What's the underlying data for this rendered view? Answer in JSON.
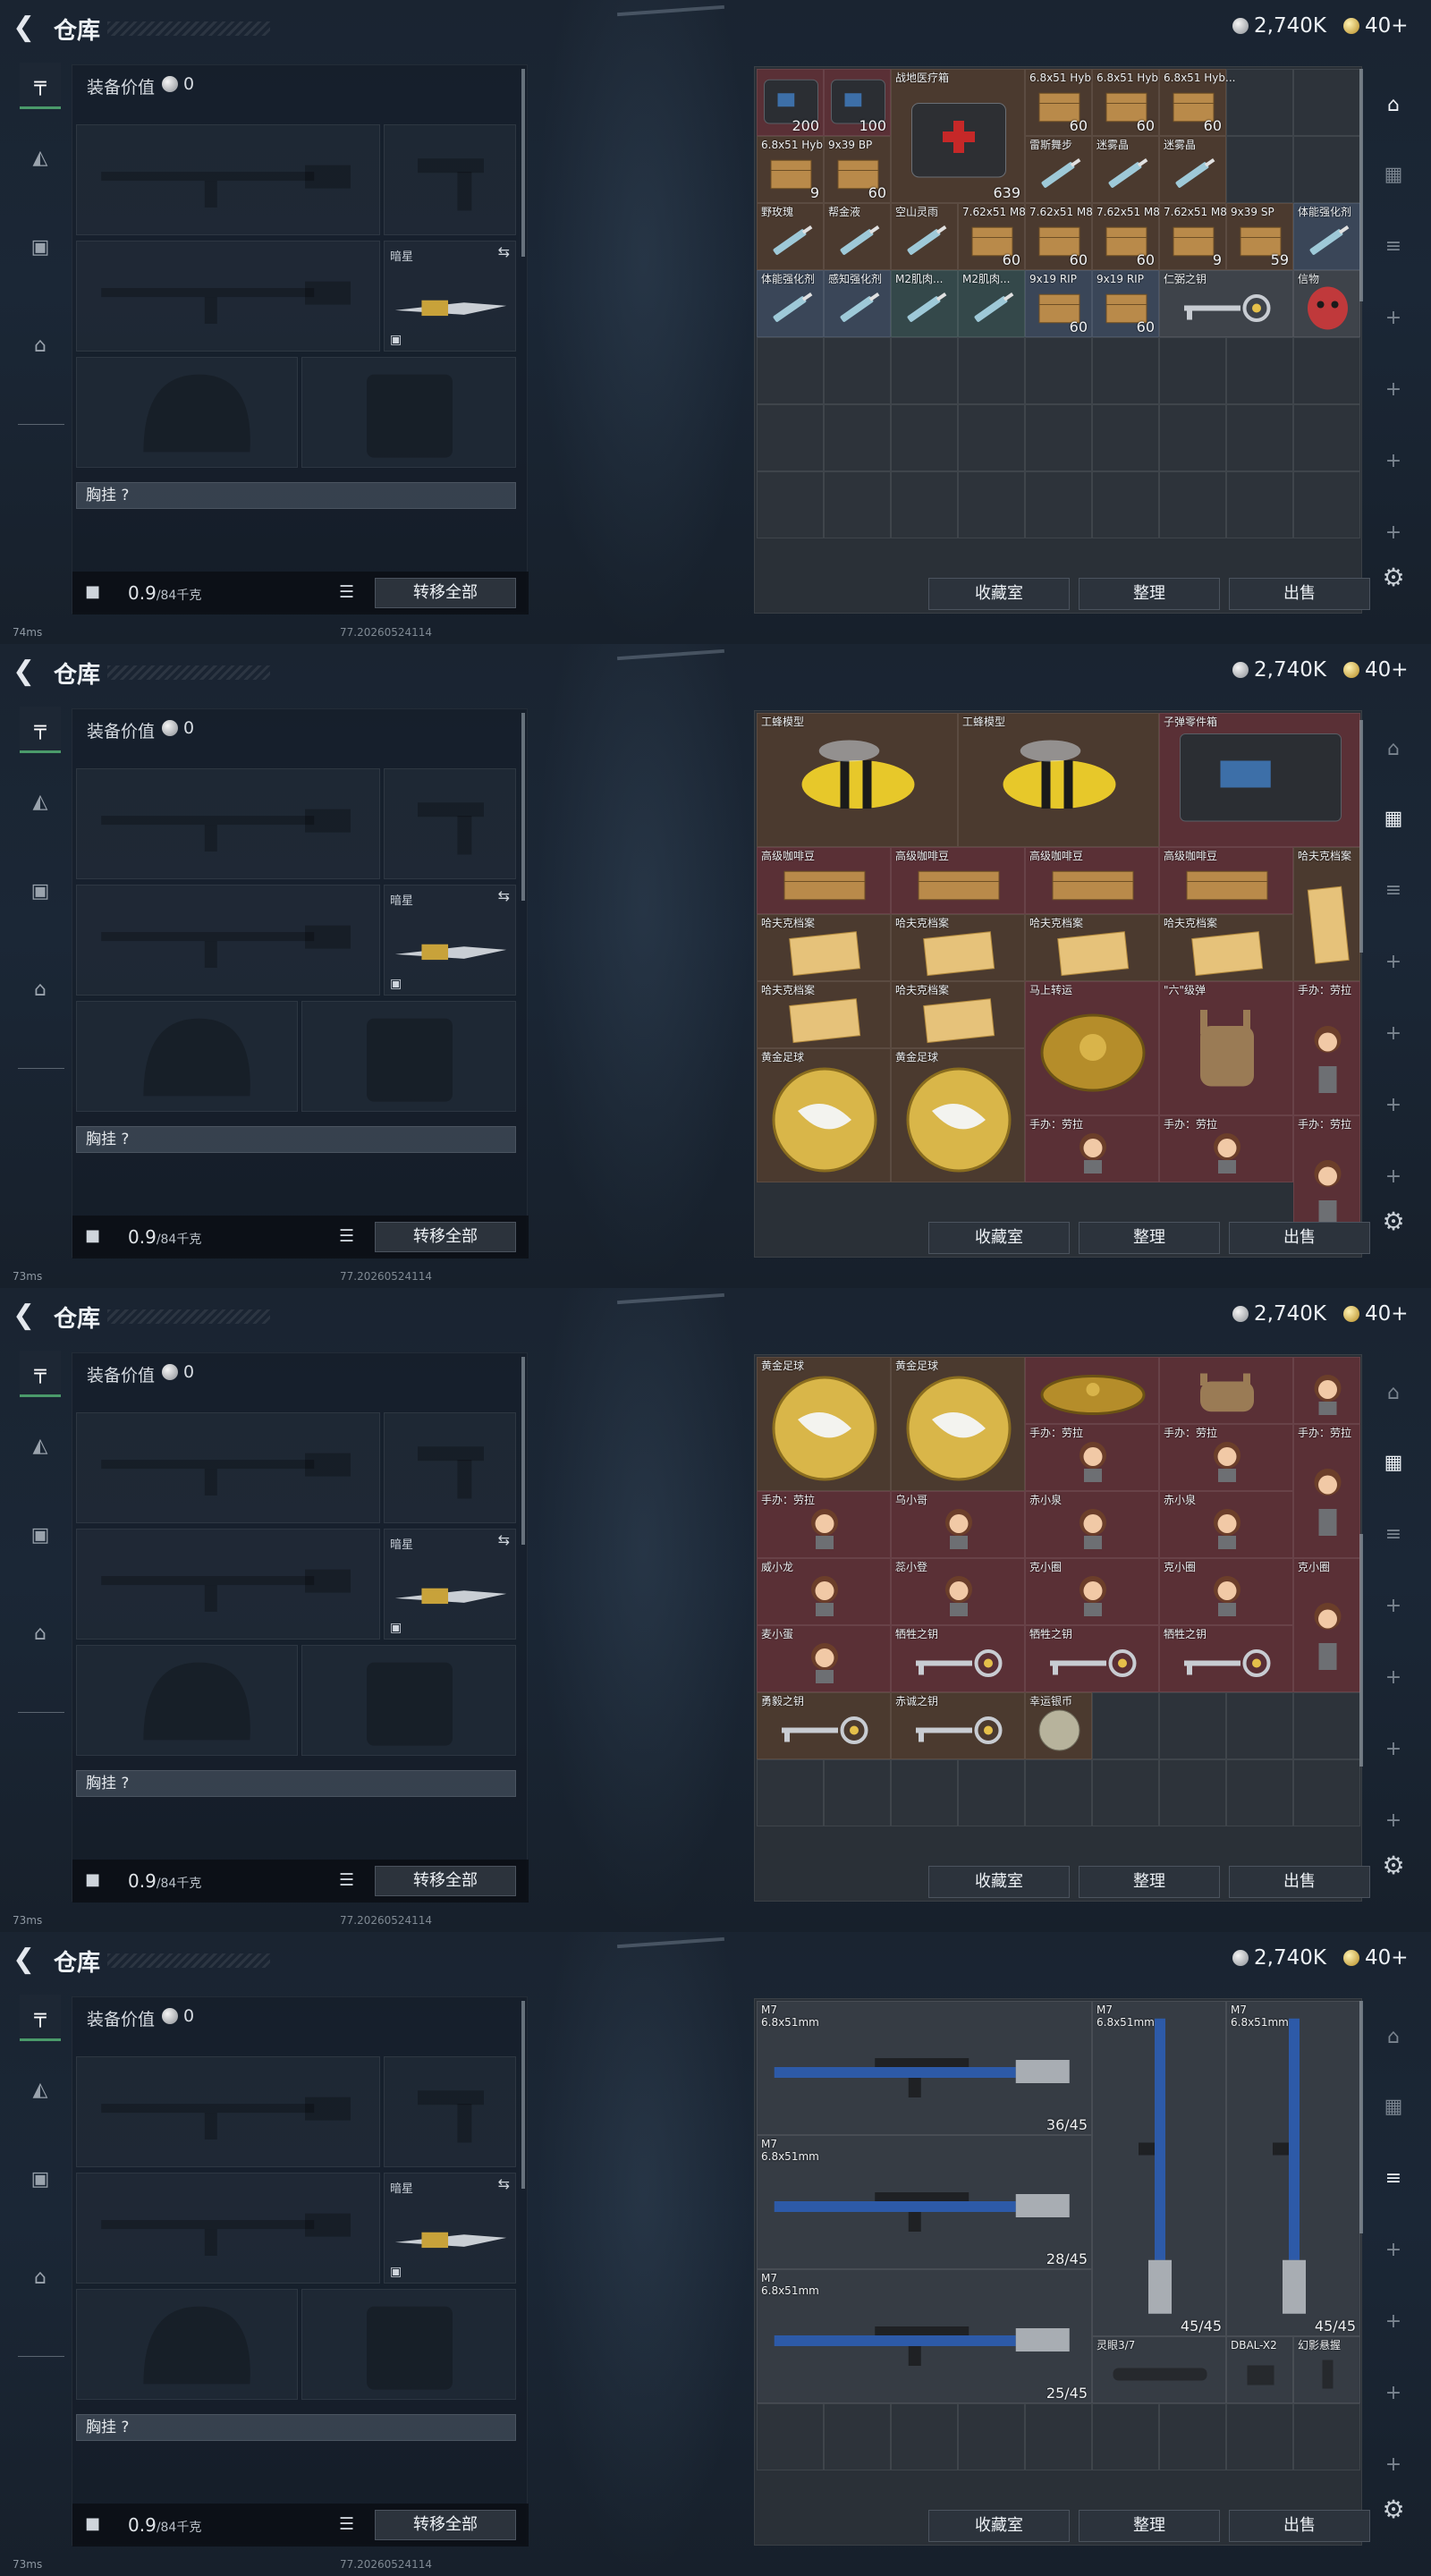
{
  "header": {
    "title": "仓库",
    "silver": "2,740K",
    "gold": "40+"
  },
  "equip": {
    "title": "装备价值",
    "value": "0",
    "melee_label": "暗星",
    "chest_label": "胸挂 ?",
    "weight_main": "0.9",
    "weight_unit": "/84千克",
    "transfer": "转移全部"
  },
  "footer": {
    "btn1": "收藏室",
    "btn2": "整理",
    "btn3": "出售"
  },
  "panels": [
    {
      "status": "74ms",
      "build": "77.20260524114"
    },
    {
      "status": "73ms",
      "build": "77.20260524114"
    },
    {
      "status": "73ms",
      "build": "77.20260524114"
    },
    {
      "status": "73ms",
      "build": "77.20260524114"
    }
  ],
  "icons": {
    "back": "back-arrow-icon",
    "silver": "silver-coin-icon",
    "gold": "gold-coin-icon",
    "lock": "lock-icon",
    "list": "list-icon",
    "gear": "gear-icon",
    "swap": "swap-icon"
  },
  "grids": [
    {
      "cells": [
        {
          "c": 0,
          "r": 0,
          "w": 1,
          "h": 1,
          "bg": "red",
          "label": "",
          "count": "200",
          "shape": "case"
        },
        {
          "c": 1,
          "r": 0,
          "w": 1,
          "h": 1,
          "bg": "red",
          "label": "",
          "count": "100",
          "shape": "case"
        },
        {
          "c": 2,
          "r": 0,
          "w": 2,
          "h": 2,
          "bg": "brown",
          "label": "战地医疗箱",
          "count": "639",
          "shape": "medkit"
        },
        {
          "c": 4,
          "r": 0,
          "w": 1,
          "h": 1,
          "bg": "brown",
          "label": "6.8x51 Hyb...",
          "count": "60",
          "shape": "box"
        },
        {
          "c": 5,
          "r": 0,
          "w": 1,
          "h": 1,
          "bg": "brown",
          "label": "6.8x51 Hyb...",
          "count": "60",
          "shape": "box"
        },
        {
          "c": 6,
          "r": 0,
          "w": 1,
          "h": 1,
          "bg": "brown",
          "label": "6.8x51 Hyb...",
          "count": "60",
          "shape": "box"
        },
        {
          "c": 0,
          "r": 1,
          "w": 1,
          "h": 1,
          "bg": "brown",
          "label": "6.8x51 Hyb...",
          "count": "9",
          "shape": "box"
        },
        {
          "c": 1,
          "r": 1,
          "w": 1,
          "h": 1,
          "bg": "brown",
          "label": "9x39 BP",
          "count": "60",
          "shape": "box"
        },
        {
          "c": 4,
          "r": 1,
          "w": 1,
          "h": 1,
          "bg": "brown",
          "label": "雷斯舞步",
          "count": "",
          "shape": "syringe"
        },
        {
          "c": 5,
          "r": 1,
          "w": 1,
          "h": 1,
          "bg": "brown",
          "label": "迷雾晶",
          "count": "",
          "shape": "syringe"
        },
        {
          "c": 6,
          "r": 1,
          "w": 1,
          "h": 1,
          "bg": "brown",
          "label": "迷雾晶",
          "count": "",
          "shape": "syringe"
        },
        {
          "c": 0,
          "r": 2,
          "w": 1,
          "h": 1,
          "bg": "brown",
          "label": "野玫瑰",
          "count": "",
          "shape": "syringe"
        },
        {
          "c": 1,
          "r": 2,
          "w": 1,
          "h": 1,
          "bg": "brown",
          "label": "帮金液",
          "count": "",
          "shape": "syringe"
        },
        {
          "c": 2,
          "r": 2,
          "w": 1,
          "h": 1,
          "bg": "brown",
          "label": "空山灵雨",
          "count": "",
          "shape": "syringe"
        },
        {
          "c": 3,
          "r": 2,
          "w": 1,
          "h": 1,
          "bg": "brown",
          "label": "7.62x51 M80",
          "count": "60",
          "shape": "box"
        },
        {
          "c": 4,
          "r": 2,
          "w": 1,
          "h": 1,
          "bg": "brown",
          "label": "7.62x51 M80",
          "count": "60",
          "shape": "box"
        },
        {
          "c": 5,
          "r": 2,
          "w": 1,
          "h": 1,
          "bg": "brown",
          "label": "7.62x51 M80",
          "count": "60",
          "shape": "box"
        },
        {
          "c": 6,
          "r": 2,
          "w": 1,
          "h": 1,
          "bg": "brown",
          "label": "7.62x51 M80",
          "count": "9",
          "shape": "box"
        },
        {
          "c": 7,
          "r": 2,
          "w": 1,
          "h": 1,
          "bg": "brown",
          "label": "9x39 SP",
          "count": "59",
          "shape": "box"
        },
        {
          "c": 8,
          "r": 2,
          "w": 1,
          "h": 1,
          "bg": "blue",
          "label": "体能强化剂",
          "count": "",
          "shape": "syringe"
        },
        {
          "c": 0,
          "r": 3,
          "w": 1,
          "h": 1,
          "bg": "blue",
          "label": "体能强化剂",
          "count": "",
          "shape": "syringe"
        },
        {
          "c": 1,
          "r": 3,
          "w": 1,
          "h": 1,
          "bg": "blue",
          "label": "感知强化剂",
          "count": "",
          "shape": "syringe"
        },
        {
          "c": 2,
          "r": 3,
          "w": 1,
          "h": 1,
          "bg": "teal",
          "label": "M2肌肉...",
          "count": "",
          "shape": "syringe"
        },
        {
          "c": 3,
          "r": 3,
          "w": 1,
          "h": 1,
          "bg": "teal",
          "label": "M2肌肉...",
          "count": "",
          "shape": "syringe"
        },
        {
          "c": 4,
          "r": 3,
          "w": 1,
          "h": 1,
          "bg": "blue",
          "label": "9x19 RIP",
          "count": "60",
          "shape": "box"
        },
        {
          "c": 5,
          "r": 3,
          "w": 1,
          "h": 1,
          "bg": "blue",
          "label": "9x19 RIP",
          "count": "60",
          "shape": "box"
        },
        {
          "c": 6,
          "r": 3,
          "w": 2,
          "h": 1,
          "bg": "gray",
          "label": "仁弼之钥",
          "count": "",
          "shape": "key"
        },
        {
          "c": 8,
          "r": 3,
          "w": 1,
          "h": 1,
          "bg": "gray",
          "label": "信物",
          "count": "",
          "shape": "mask"
        }
      ]
    },
    {
      "cells": [
        {
          "c": 0,
          "r": 0,
          "w": 3,
          "h": 2,
          "bg": "brown",
          "label": "工蜂模型",
          "count": "",
          "shape": "bee"
        },
        {
          "c": 3,
          "r": 0,
          "w": 3,
          "h": 2,
          "bg": "brown",
          "label": "工蜂模型",
          "count": "",
          "shape": "bee"
        },
        {
          "c": 6,
          "r": 0,
          "w": 3,
          "h": 2,
          "bg": "red",
          "label": "子弹零件箱",
          "count": "",
          "shape": "case"
        },
        {
          "c": 0,
          "r": 2,
          "w": 2,
          "h": 1,
          "bg": "red",
          "label": "高级咖啡豆",
          "count": "",
          "shape": "box"
        },
        {
          "c": 2,
          "r": 2,
          "w": 2,
          "h": 1,
          "bg": "red",
          "label": "高级咖啡豆",
          "count": "",
          "shape": "box"
        },
        {
          "c": 4,
          "r": 2,
          "w": 2,
          "h": 1,
          "bg": "red",
          "label": "高级咖啡豆",
          "count": "",
          "shape": "box"
        },
        {
          "c": 6,
          "r": 2,
          "w": 2,
          "h": 1,
          "bg": "red",
          "label": "高级咖啡豆",
          "count": "",
          "shape": "box"
        },
        {
          "c": 8,
          "r": 2,
          "w": 1,
          "h": 2,
          "bg": "brown",
          "label": "哈夫克档案",
          "count": "",
          "shape": "paper"
        },
        {
          "c": 0,
          "r": 3,
          "w": 2,
          "h": 1,
          "bg": "brown",
          "label": "哈夫克档案",
          "count": "",
          "shape": "paper"
        },
        {
          "c": 2,
          "r": 3,
          "w": 2,
          "h": 1,
          "bg": "brown",
          "label": "哈夫克档案",
          "count": "",
          "shape": "paper"
        },
        {
          "c": 4,
          "r": 3,
          "w": 2,
          "h": 1,
          "bg": "brown",
          "label": "哈夫克档案",
          "count": "",
          "shape": "paper"
        },
        {
          "c": 6,
          "r": 3,
          "w": 2,
          "h": 1,
          "bg": "brown",
          "label": "哈夫克档案",
          "count": "",
          "shape": "paper"
        },
        {
          "c": 0,
          "r": 4,
          "w": 2,
          "h": 1,
          "bg": "brown",
          "label": "哈夫克档案",
          "count": "",
          "shape": "paper"
        },
        {
          "c": 2,
          "r": 4,
          "w": 2,
          "h": 1,
          "bg": "brown",
          "label": "哈夫克档案",
          "count": "",
          "shape": "paper"
        },
        {
          "c": 4,
          "r": 4,
          "w": 2,
          "h": 2,
          "bg": "red",
          "label": "马上转运",
          "count": "",
          "shape": "disc"
        },
        {
          "c": 6,
          "r": 4,
          "w": 2,
          "h": 2,
          "bg": "red",
          "label": "\"六\"级弹",
          "count": "",
          "shape": "glove"
        },
        {
          "c": 8,
          "r": 4,
          "w": 1,
          "h": 2,
          "bg": "red",
          "label": "手办：劳拉",
          "count": "",
          "shape": "doll"
        },
        {
          "c": 0,
          "r": 5,
          "w": 2,
          "h": 2,
          "bg": "brown",
          "label": "黄金足球",
          "count": "",
          "shape": "ball"
        },
        {
          "c": 2,
          "r": 5,
          "w": 2,
          "h": 2,
          "bg": "brown",
          "label": "黄金足球",
          "count": "",
          "shape": "ball"
        },
        {
          "c": 4,
          "r": 6,
          "w": 2,
          "h": 1,
          "bg": "red",
          "label": "手办：劳拉",
          "count": "",
          "shape": "doll"
        },
        {
          "c": 6,
          "r": 6,
          "w": 2,
          "h": 1,
          "bg": "red",
          "label": "手办：劳拉",
          "count": "",
          "shape": "doll"
        },
        {
          "c": 8,
          "r": 6,
          "w": 1,
          "h": 2,
          "bg": "red",
          "label": "手办：劳拉",
          "count": "",
          "shape": "doll"
        }
      ]
    },
    {
      "cells": [
        {
          "c": 0,
          "r": 0,
          "w": 2,
          "h": 2,
          "bg": "brown",
          "label": "黄金足球",
          "count": "",
          "shape": "ball"
        },
        {
          "c": 2,
          "r": 0,
          "w": 2,
          "h": 2,
          "bg": "brown",
          "label": "黄金足球",
          "count": "",
          "shape": "ball"
        },
        {
          "c": 4,
          "r": 0,
          "w": 2,
          "h": 1,
          "bg": "red",
          "label": "",
          "count": "",
          "shape": "disc"
        },
        {
          "c": 6,
          "r": 0,
          "w": 2,
          "h": 1,
          "bg": "red",
          "label": "",
          "count": "",
          "shape": "glove"
        },
        {
          "c": 8,
          "r": 0,
          "w": 1,
          "h": 1,
          "bg": "red",
          "label": "",
          "count": "",
          "shape": "doll"
        },
        {
          "c": 4,
          "r": 1,
          "w": 2,
          "h": 1,
          "bg": "red",
          "label": "手办：劳拉",
          "count": "",
          "shape": "doll"
        },
        {
          "c": 6,
          "r": 1,
          "w": 2,
          "h": 1,
          "bg": "red",
          "label": "手办：劳拉",
          "count": "",
          "shape": "doll"
        },
        {
          "c": 8,
          "r": 1,
          "w": 1,
          "h": 2,
          "bg": "red",
          "label": "手办：劳拉",
          "count": "",
          "shape": "doll"
        },
        {
          "c": 0,
          "r": 2,
          "w": 2,
          "h": 1,
          "bg": "red",
          "label": "手办：劳拉",
          "count": "",
          "shape": "doll"
        },
        {
          "c": 2,
          "r": 2,
          "w": 2,
          "h": 1,
          "bg": "red",
          "label": "乌小哥",
          "count": "",
          "shape": "doll"
        },
        {
          "c": 4,
          "r": 2,
          "w": 2,
          "h": 1,
          "bg": "red",
          "label": "赤小泉",
          "count": "",
          "shape": "doll"
        },
        {
          "c": 6,
          "r": 2,
          "w": 2,
          "h": 1,
          "bg": "red",
          "label": "赤小泉",
          "count": "",
          "shape": "doll"
        },
        {
          "c": 0,
          "r": 3,
          "w": 2,
          "h": 1,
          "bg": "red",
          "label": "威小龙",
          "count": "",
          "shape": "doll"
        },
        {
          "c": 2,
          "r": 3,
          "w": 2,
          "h": 1,
          "bg": "red",
          "label": "蕊小登",
          "count": "",
          "shape": "doll"
        },
        {
          "c": 4,
          "r": 3,
          "w": 2,
          "h": 1,
          "bg": "red",
          "label": "克小圈",
          "count": "",
          "shape": "doll"
        },
        {
          "c": 6,
          "r": 3,
          "w": 2,
          "h": 1,
          "bg": "red",
          "label": "克小圈",
          "count": "",
          "shape": "doll"
        },
        {
          "c": 8,
          "r": 3,
          "w": 1,
          "h": 2,
          "bg": "red",
          "label": "克小圈",
          "count": "",
          "shape": "doll"
        },
        {
          "c": 0,
          "r": 4,
          "w": 2,
          "h": 1,
          "bg": "red",
          "label": "麦小蛋",
          "count": "",
          "shape": "doll"
        },
        {
          "c": 2,
          "r": 4,
          "w": 2,
          "h": 1,
          "bg": "red",
          "label": "牺牲之钥",
          "count": "",
          "shape": "key"
        },
        {
          "c": 4,
          "r": 4,
          "w": 2,
          "h": 1,
          "bg": "red",
          "label": "牺牲之钥",
          "count": "",
          "shape": "key"
        },
        {
          "c": 6,
          "r": 4,
          "w": 2,
          "h": 1,
          "bg": "red",
          "label": "牺牲之钥",
          "count": "",
          "shape": "key"
        },
        {
          "c": 0,
          "r": 5,
          "w": 2,
          "h": 1,
          "bg": "brown",
          "label": "勇毅之钥",
          "count": "",
          "shape": "key"
        },
        {
          "c": 2,
          "r": 5,
          "w": 2,
          "h": 1,
          "bg": "brown",
          "label": "赤诚之钥",
          "count": "",
          "shape": "key"
        },
        {
          "c": 4,
          "r": 5,
          "w": 1,
          "h": 1,
          "bg": "brown",
          "label": "幸运银币",
          "count": "",
          "shape": "coin"
        }
      ]
    },
    {
      "cells": [
        {
          "c": 0,
          "r": 0,
          "w": 5,
          "h": 2,
          "bg": "plain",
          "label": "M7\n6.8x51mm",
          "count": "36/45",
          "shape": "rifle"
        },
        {
          "c": 5,
          "r": 0,
          "w": 2,
          "h": 5,
          "bg": "plain",
          "label": "M7\n6.8x51mm",
          "count": "45/45",
          "shape": "vrifle"
        },
        {
          "c": 7,
          "r": 0,
          "w": 2,
          "h": 5,
          "bg": "plain",
          "label": "M7\n6.8x51mm",
          "count": "45/45",
          "shape": "vrifle"
        },
        {
          "c": 0,
          "r": 2,
          "w": 5,
          "h": 2,
          "bg": "plain",
          "label": "M7\n6.8x51mm",
          "count": "28/45",
          "shape": "rifle"
        },
        {
          "c": 0,
          "r": 4,
          "w": 5,
          "h": 2,
          "bg": "plain",
          "label": "M7\n6.8x51mm",
          "count": "25/45",
          "shape": "rifle"
        },
        {
          "c": 5,
          "r": 5,
          "w": 2,
          "h": 1,
          "bg": "plain",
          "label": "灵眼3/7",
          "count": "",
          "shape": "scope"
        },
        {
          "c": 7,
          "r": 5,
          "w": 1,
          "h": 1,
          "bg": "plain",
          "label": "DBAL-X2",
          "count": "",
          "shape": "laser"
        },
        {
          "c": 8,
          "r": 5,
          "w": 1,
          "h": 1,
          "bg": "plain",
          "label": "幻影悬握",
          "count": "",
          "shape": "grip"
        }
      ]
    }
  ]
}
